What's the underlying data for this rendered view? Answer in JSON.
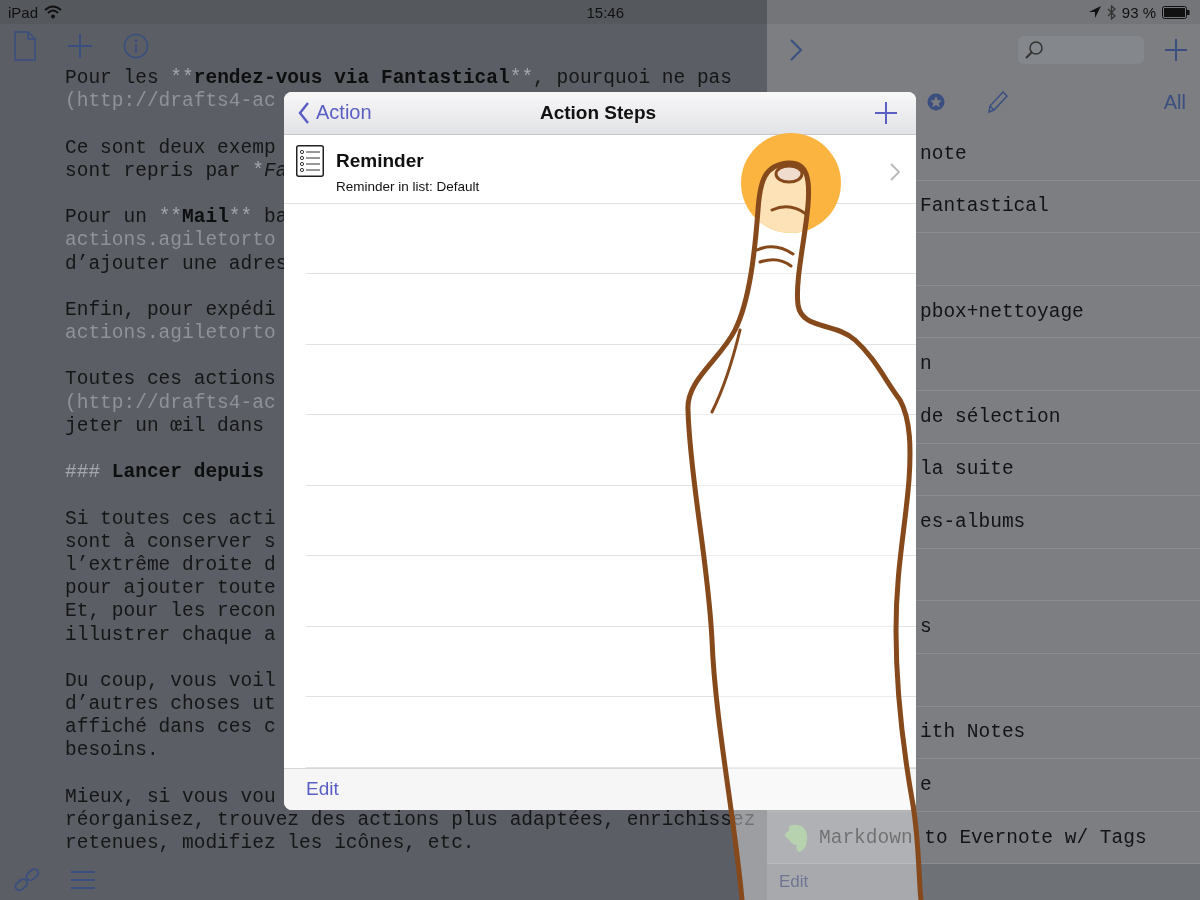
{
  "status_bar": {
    "carrier": "iPad",
    "time": "15:46",
    "battery": "93 %"
  },
  "editor": {
    "lines": [
      {
        "kind": "text",
        "segments": [
          {
            "kind": "plain",
            "text": "Pour les "
          },
          {
            "kind": "syntax",
            "text": "**"
          },
          {
            "kind": "bold",
            "text": "rendez-vous via Fantastical"
          },
          {
            "kind": "syntax",
            "text": "**"
          },
          {
            "kind": "plain",
            "text": ", pourquoi ne pas"
          }
        ]
      },
      {
        "kind": "text",
        "segments": [
          {
            "kind": "link",
            "text": "(http://drafts4-ac"
          }
        ]
      },
      {
        "kind": "blank"
      },
      {
        "kind": "text",
        "segments": [
          {
            "kind": "plain",
            "text": "Ce sont deux exemp"
          }
        ]
      },
      {
        "kind": "text",
        "segments": [
          {
            "kind": "plain",
            "text": "sont repris par "
          },
          {
            "kind": "syntax",
            "text": "*"
          },
          {
            "kind": "italic",
            "text": "Fa"
          }
        ]
      },
      {
        "kind": "blank"
      },
      {
        "kind": "text",
        "segments": [
          {
            "kind": "plain",
            "text": "Pour un "
          },
          {
            "kind": "syntax",
            "text": "**"
          },
          {
            "kind": "bold",
            "text": "Mail"
          },
          {
            "kind": "syntax",
            "text": "**"
          },
          {
            "kind": "plain",
            "text": " ba"
          }
        ]
      },
      {
        "kind": "text",
        "segments": [
          {
            "kind": "link",
            "text": "actions.agiletorto"
          }
        ]
      },
      {
        "kind": "text",
        "segments": [
          {
            "kind": "plain",
            "text": "d’ajouter une adres"
          }
        ]
      },
      {
        "kind": "blank"
      },
      {
        "kind": "text",
        "segments": [
          {
            "kind": "plain",
            "text": "Enfin, pour expédi"
          }
        ]
      },
      {
        "kind": "text",
        "segments": [
          {
            "kind": "link",
            "text": "actions.agiletorto"
          }
        ]
      },
      {
        "kind": "blank"
      },
      {
        "kind": "text",
        "segments": [
          {
            "kind": "plain",
            "text": "Toutes ces actions"
          }
        ]
      },
      {
        "kind": "text",
        "segments": [
          {
            "kind": "link",
            "text": "(http://drafts4-ac"
          }
        ]
      },
      {
        "kind": "text",
        "segments": [
          {
            "kind": "plain",
            "text": "jeter un œil dans"
          }
        ]
      },
      {
        "kind": "blank"
      },
      {
        "kind": "text",
        "segments": [
          {
            "kind": "syntax",
            "text": "### "
          },
          {
            "kind": "bold",
            "text": "Lancer depuis"
          }
        ]
      },
      {
        "kind": "blank"
      },
      {
        "kind": "text",
        "segments": [
          {
            "kind": "plain",
            "text": "Si toutes ces acti"
          }
        ]
      },
      {
        "kind": "text",
        "segments": [
          {
            "kind": "plain",
            "text": "sont à conserver s"
          }
        ]
      },
      {
        "kind": "text",
        "segments": [
          {
            "kind": "plain",
            "text": "l’extrême droite d"
          }
        ]
      },
      {
        "kind": "text",
        "segments": [
          {
            "kind": "plain",
            "text": "pour ajouter toute"
          }
        ]
      },
      {
        "kind": "text",
        "segments": [
          {
            "kind": "plain",
            "text": "Et, pour les recon"
          }
        ]
      },
      {
        "kind": "text",
        "segments": [
          {
            "kind": "plain",
            "text": "illustrer chaque a"
          }
        ]
      },
      {
        "kind": "blank"
      },
      {
        "kind": "text",
        "segments": [
          {
            "kind": "plain",
            "text": "Du coup, vous voil"
          }
        ]
      },
      {
        "kind": "text",
        "segments": [
          {
            "kind": "plain",
            "text": "d’autres choses ut"
          }
        ]
      },
      {
        "kind": "text",
        "segments": [
          {
            "kind": "plain",
            "text": "affiché dans ces c"
          }
        ]
      },
      {
        "kind": "text",
        "segments": [
          {
            "kind": "plain",
            "text": "besoins."
          }
        ]
      },
      {
        "kind": "blank"
      },
      {
        "kind": "text",
        "segments": [
          {
            "kind": "plain",
            "text": "Mieux, si vous vou"
          }
        ]
      },
      {
        "kind": "text",
        "segments": [
          {
            "kind": "plain",
            "text": "réorganisez, trouvez des actions plus adaptées, enrichissez"
          }
        ]
      },
      {
        "kind": "text",
        "segments": [
          {
            "kind": "plain",
            "text": "retenues, modifiez les icônes, etc."
          }
        ]
      }
    ]
  },
  "sidebar": {
    "filter": "All",
    "bottom_button": "Edit",
    "items": [
      {
        "kind": "text",
        "title": "note"
      },
      {
        "kind": "text",
        "title": "Fantastical"
      },
      {
        "kind": "covered"
      },
      {
        "kind": "text",
        "title": "pbox+nettoyage"
      },
      {
        "kind": "text",
        "title": "n"
      },
      {
        "kind": "text",
        "title": "de sélection"
      },
      {
        "kind": "text",
        "title": "la suite"
      },
      {
        "kind": "text",
        "title": "es-albums"
      },
      {
        "kind": "covered"
      },
      {
        "kind": "text",
        "title": "s"
      },
      {
        "kind": "covered"
      },
      {
        "kind": "text",
        "title": "ith Notes"
      },
      {
        "kind": "text",
        "title": "e"
      },
      {
        "kind": "evernote",
        "title": "Markdown to Evernote w/ Tags"
      }
    ]
  },
  "modal": {
    "back": "Action",
    "title": "Action Steps",
    "edit": "Edit",
    "steps": [
      {
        "title": "Reminder",
        "subtitle": "Reminder in list: Default"
      }
    ]
  }
}
